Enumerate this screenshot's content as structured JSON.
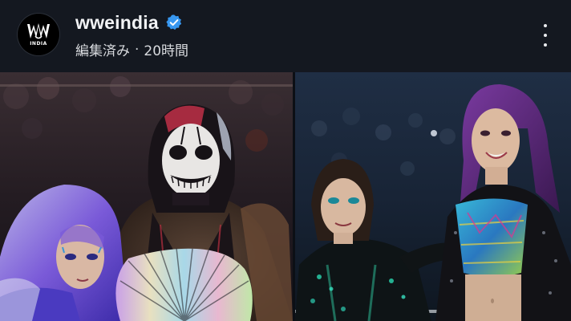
{
  "post": {
    "account": {
      "username": "wweindia",
      "verified": true,
      "avatar_logo_text": "INDIA"
    },
    "meta": {
      "status": "編集済み",
      "separator": "·",
      "time_ago": "20時間"
    },
    "more_icon": "more-vertical-icon",
    "media": {
      "photo_count": 2
    }
  },
  "colors": {
    "background": "#12161e",
    "text_primary": "#f2f3f5",
    "text_secondary": "#d8dade",
    "verified_blue": "#3797f0"
  }
}
